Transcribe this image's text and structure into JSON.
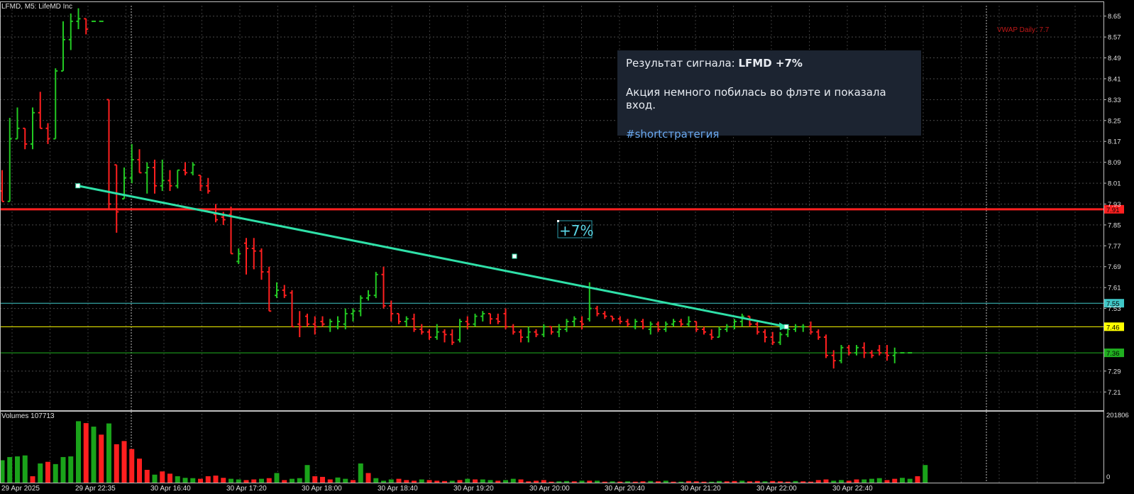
{
  "chart_data": {
    "type": "candlestick",
    "title": "LFMD, M5:  LifeMD Inc",
    "ylim": [
      7.14,
      8.69
    ],
    "y_ticks": [
      "8.65",
      "8.57",
      "8.49",
      "8.41",
      "8.33",
      "8.25",
      "8.17",
      "8.09",
      "8.01",
      "7.93",
      "7.85",
      "7.77",
      "7.69",
      "7.61",
      "7.53",
      "7.29",
      "7.21"
    ],
    "x_tick_labels": [
      "29 Apr 2025",
      "29 Apr 22:35",
      "30 Apr 16:40",
      "30 Apr 17:20",
      "30 Apr 18:00",
      "30 Apr 18:40",
      "30 Apr 19:20",
      "30 Apr 20:00",
      "30 Apr 20:40",
      "30 Apr 21:20",
      "30 Apr 22:00",
      "30 Apr 22:40"
    ],
    "vwap_label": "VWAP Daily: 7.7",
    "price_levels": [
      {
        "label": "7.91",
        "value": 7.91,
        "color": "#ff2020"
      },
      {
        "label": "7.55",
        "value": 7.55,
        "color": "#40c8c8"
      },
      {
        "label": "7.46",
        "value": 7.46,
        "color": "#ffff00"
      },
      {
        "label": "7.36",
        "value": 7.36,
        "color": "#20b020"
      }
    ],
    "trend_line": {
      "start": [
        9,
        8.0
      ],
      "mid": [
        44,
        7.73
      ],
      "end": [
        79,
        7.46
      ]
    },
    "trend_label": "+7%",
    "candles": [
      [
        7.98,
        8.06,
        7.94,
        7.94
      ],
      [
        7.94,
        8.26,
        7.94,
        8.18
      ],
      [
        8.18,
        8.3,
        8.18,
        8.22
      ],
      [
        8.22,
        8.22,
        8.14,
        8.16
      ],
      [
        8.16,
        8.3,
        8.14,
        8.28
      ],
      [
        8.28,
        8.36,
        8.22,
        8.22
      ],
      [
        8.22,
        8.24,
        8.16,
        8.18
      ],
      [
        8.18,
        8.45,
        8.18,
        8.44
      ],
      [
        8.44,
        8.63,
        8.44,
        8.56
      ],
      [
        8.56,
        8.66,
        8.52,
        8.63
      ],
      [
        8.63,
        8.68,
        8.6,
        8.64
      ],
      [
        8.64,
        8.64,
        8.58,
        8.6
      ],
      [
        8.63,
        8.63,
        8.63,
        8.63
      ],
      [
        8.63,
        8.63,
        8.63,
        8.63
      ],
      [
        8.33,
        8.33,
        7.91,
        7.93
      ],
      [
        8.08,
        8.08,
        7.82,
        7.9
      ],
      [
        7.95,
        8.07,
        7.95,
        8.03
      ],
      [
        8.03,
        8.16,
        8.01,
        8.1
      ],
      [
        8.1,
        8.14,
        8.05,
        8.05
      ],
      [
        8.05,
        8.09,
        7.97,
        8.07
      ],
      [
        8.07,
        8.1,
        7.97,
        8.0
      ],
      [
        8.0,
        8.1,
        7.98,
        8.02
      ],
      [
        8.02,
        8.06,
        7.98,
        8.0
      ],
      [
        8.0,
        8.06,
        7.99,
        8.06
      ],
      [
        8.06,
        8.09,
        8.04,
        8.05
      ],
      [
        8.05,
        8.09,
        8.04,
        8.08
      ],
      [
        8.04,
        8.04,
        7.98,
        8.0
      ],
      [
        8.0,
        8.03,
        7.97,
        7.98
      ],
      [
        7.89,
        7.93,
        7.86,
        7.87
      ],
      [
        7.88,
        7.9,
        7.85,
        7.87
      ],
      [
        7.89,
        7.92,
        7.74,
        7.74
      ],
      [
        7.71,
        7.76,
        7.7,
        7.74
      ],
      [
        7.78,
        7.8,
        7.66,
        7.76
      ],
      [
        7.76,
        7.8,
        7.68,
        7.75
      ],
      [
        7.75,
        7.76,
        7.64,
        7.67
      ],
      [
        7.67,
        7.69,
        7.52,
        7.52
      ],
      [
        7.58,
        7.63,
        7.57,
        7.6
      ],
      [
        7.6,
        7.62,
        7.57,
        7.58
      ],
      [
        7.59,
        7.6,
        7.46,
        7.46
      ],
      [
        7.47,
        7.52,
        7.42,
        7.46
      ],
      [
        7.5,
        7.51,
        7.46,
        7.47
      ],
      [
        7.47,
        7.5,
        7.43,
        7.46
      ],
      [
        7.48,
        7.5,
        7.46,
        7.47
      ],
      [
        7.46,
        7.49,
        7.44,
        7.48
      ],
      [
        7.46,
        7.5,
        7.45,
        7.48
      ],
      [
        7.47,
        7.53,
        7.45,
        7.51
      ],
      [
        7.51,
        7.53,
        7.48,
        7.52
      ],
      [
        7.52,
        7.58,
        7.5,
        7.57
      ],
      [
        7.57,
        7.6,
        7.56,
        7.58
      ],
      [
        7.58,
        7.67,
        7.57,
        7.66
      ],
      [
        7.66,
        7.69,
        7.53,
        7.54
      ],
      [
        7.54,
        7.56,
        7.48,
        7.51
      ],
      [
        7.51,
        7.51,
        7.47,
        7.48
      ],
      [
        7.48,
        7.5,
        7.46,
        7.49
      ],
      [
        7.49,
        7.51,
        7.44,
        7.45
      ],
      [
        7.45,
        7.47,
        7.43,
        7.44
      ],
      [
        7.44,
        7.45,
        7.41,
        7.42
      ],
      [
        7.42,
        7.47,
        7.41,
        7.44
      ],
      [
        7.44,
        7.45,
        7.4,
        7.43
      ],
      [
        7.43,
        7.45,
        7.39,
        7.4
      ],
      [
        7.41,
        7.49,
        7.4,
        7.48
      ],
      [
        7.48,
        7.5,
        7.45,
        7.47
      ],
      [
        7.47,
        7.51,
        7.46,
        7.5
      ],
      [
        7.5,
        7.52,
        7.48,
        7.51
      ],
      [
        7.51,
        7.51,
        7.47,
        7.49
      ],
      [
        7.49,
        7.51,
        7.47,
        7.48
      ],
      [
        7.51,
        7.53,
        7.45,
        7.46
      ],
      [
        7.46,
        7.47,
        7.43,
        7.44
      ],
      [
        7.44,
        7.45,
        7.4,
        7.42
      ],
      [
        7.42,
        7.46,
        7.4,
        7.44
      ],
      [
        7.44,
        7.45,
        7.42,
        7.43
      ],
      [
        7.43,
        7.47,
        7.42,
        7.46
      ],
      [
        7.46,
        7.46,
        7.43,
        7.44
      ],
      [
        7.44,
        7.47,
        7.42,
        7.45
      ],
      [
        7.45,
        7.49,
        7.44,
        7.48
      ],
      [
        7.48,
        7.5,
        7.46,
        7.49
      ],
      [
        7.48,
        7.5,
        7.45,
        7.47
      ],
      [
        7.49,
        7.63,
        7.48,
        7.53
      ],
      [
        7.53,
        7.54,
        7.5,
        7.51
      ],
      [
        7.51,
        7.52,
        7.49,
        7.5
      ],
      [
        7.5,
        7.5,
        7.48,
        7.49
      ],
      [
        7.49,
        7.5,
        7.47,
        7.48
      ],
      [
        7.48,
        7.49,
        7.46,
        7.47
      ],
      [
        7.46,
        7.49,
        7.45,
        7.48
      ],
      [
        7.48,
        7.49,
        7.45,
        7.46
      ],
      [
        7.45,
        7.48,
        7.43,
        7.47
      ],
      [
        7.47,
        7.48,
        7.44,
        7.45
      ],
      [
        7.45,
        7.48,
        7.44,
        7.47
      ],
      [
        7.47,
        7.49,
        7.46,
        7.48
      ],
      [
        7.48,
        7.49,
        7.46,
        7.47
      ],
      [
        7.47,
        7.5,
        7.46,
        7.48
      ],
      [
        7.48,
        7.48,
        7.44,
        7.45
      ],
      [
        7.45,
        7.46,
        7.43,
        7.44
      ],
      [
        7.43,
        7.45,
        7.41,
        7.42
      ],
      [
        7.42,
        7.46,
        7.42,
        7.45
      ],
      [
        7.45,
        7.47,
        7.44,
        7.46
      ],
      [
        7.46,
        7.49,
        7.45,
        7.48
      ],
      [
        7.48,
        7.51,
        7.46,
        7.5
      ],
      [
        7.5,
        7.5,
        7.46,
        7.47
      ],
      [
        7.47,
        7.48,
        7.43,
        7.44
      ],
      [
        7.44,
        7.45,
        7.4,
        7.42
      ],
      [
        7.42,
        7.44,
        7.39,
        7.4
      ],
      [
        7.4,
        7.44,
        7.39,
        7.43
      ],
      [
        7.43,
        7.46,
        7.42,
        7.45
      ],
      [
        7.45,
        7.47,
        7.44,
        7.46
      ],
      [
        7.46,
        7.47,
        7.44,
        7.46
      ],
      [
        7.46,
        7.48,
        7.43,
        7.44
      ],
      [
        7.44,
        7.45,
        7.41,
        7.42
      ],
      [
        7.42,
        7.43,
        7.34,
        7.35
      ],
      [
        7.35,
        7.37,
        7.3,
        7.33
      ],
      [
        7.33,
        7.39,
        7.32,
        7.38
      ],
      [
        7.38,
        7.39,
        7.35,
        7.36
      ],
      [
        7.36,
        7.39,
        7.35,
        7.38
      ],
      [
        7.38,
        7.4,
        7.34,
        7.36
      ],
      [
        7.36,
        7.37,
        7.34,
        7.35
      ],
      [
        7.37,
        7.39,
        7.35,
        7.36
      ],
      [
        7.36,
        7.39,
        7.33,
        7.35
      ],
      [
        7.35,
        7.38,
        7.32,
        7.36
      ],
      [
        7.36,
        7.36,
        7.36,
        7.36
      ],
      [
        7.36,
        7.36,
        7.36,
        7.36
      ]
    ],
    "volume_label": "Volumes 107713",
    "volume_max_label": "201806",
    "volume_zero_label": "0",
    "volume_max": 201806,
    "volumes": [
      [
        70000,
        "g"
      ],
      [
        80000,
        "g"
      ],
      [
        82000,
        "g"
      ],
      [
        85000,
        "g"
      ],
      [
        20000,
        "r"
      ],
      [
        60000,
        "g"
      ],
      [
        65000,
        "r"
      ],
      [
        58000,
        "g"
      ],
      [
        80000,
        "g"
      ],
      [
        82000,
        "g"
      ],
      [
        192000,
        "g"
      ],
      [
        186000,
        "r"
      ],
      [
        175000,
        "g"
      ],
      [
        150000,
        "r"
      ],
      [
        185000,
        "g"
      ],
      [
        120000,
        "r"
      ],
      [
        130000,
        "r"
      ],
      [
        105000,
        "r"
      ],
      [
        75000,
        "r"
      ],
      [
        40000,
        "r"
      ],
      [
        25000,
        "g"
      ],
      [
        35000,
        "r"
      ],
      [
        28000,
        "r"
      ],
      [
        20000,
        "g"
      ],
      [
        15000,
        "g"
      ],
      [
        14000,
        "g"
      ],
      [
        12000,
        "r"
      ],
      [
        20000,
        "r"
      ],
      [
        22000,
        "r"
      ],
      [
        15000,
        "r"
      ],
      [
        12000,
        "g"
      ],
      [
        10000,
        "g"
      ],
      [
        8000,
        "r"
      ],
      [
        10000,
        "r"
      ],
      [
        12000,
        "g"
      ],
      [
        14000,
        "r"
      ],
      [
        30000,
        "g"
      ],
      [
        8000,
        "r"
      ],
      [
        12000,
        "g"
      ],
      [
        14000,
        "g"
      ],
      [
        55000,
        "g"
      ],
      [
        20000,
        "r"
      ],
      [
        18000,
        "r"
      ],
      [
        10000,
        "r"
      ],
      [
        16000,
        "g"
      ],
      [
        12000,
        "g"
      ],
      [
        8000,
        "r"
      ],
      [
        60000,
        "g"
      ],
      [
        30000,
        "r"
      ],
      [
        14000,
        "g"
      ],
      [
        6000,
        "g"
      ],
      [
        10000,
        "g"
      ],
      [
        12000,
        "r"
      ],
      [
        8000,
        "r"
      ],
      [
        6000,
        "r"
      ],
      [
        10000,
        "g"
      ],
      [
        8000,
        "r"
      ],
      [
        6000,
        "r"
      ],
      [
        5000,
        "r"
      ],
      [
        6000,
        "g"
      ],
      [
        8000,
        "r"
      ],
      [
        12000,
        "g"
      ],
      [
        10000,
        "r"
      ],
      [
        10000,
        "g"
      ],
      [
        8000,
        "g"
      ],
      [
        6000,
        "r"
      ],
      [
        8000,
        "g"
      ],
      [
        12000,
        "g"
      ],
      [
        10000,
        "r"
      ],
      [
        4000,
        "r"
      ],
      [
        6000,
        "r"
      ],
      [
        8000,
        "r"
      ],
      [
        3000,
        "r"
      ],
      [
        4000,
        "g"
      ],
      [
        5000,
        "g"
      ],
      [
        4000,
        "r"
      ],
      [
        6000,
        "g"
      ],
      [
        6000,
        "r"
      ],
      [
        6000,
        "g"
      ],
      [
        3000,
        "r"
      ],
      [
        4000,
        "g"
      ],
      [
        3000,
        "r"
      ],
      [
        4000,
        "g"
      ],
      [
        3000,
        "r"
      ],
      [
        4000,
        "r"
      ],
      [
        5000,
        "g"
      ],
      [
        4000,
        "r"
      ],
      [
        6000,
        "g"
      ],
      [
        3000,
        "r"
      ],
      [
        3000,
        "g"
      ],
      [
        5000,
        "r"
      ],
      [
        4000,
        "r"
      ],
      [
        3000,
        "r"
      ],
      [
        3000,
        "g"
      ],
      [
        5000,
        "g"
      ],
      [
        4000,
        "r"
      ],
      [
        5000,
        "r"
      ],
      [
        6000,
        "g"
      ],
      [
        4000,
        "r"
      ],
      [
        5000,
        "r"
      ],
      [
        4000,
        "g"
      ],
      [
        5000,
        "r"
      ],
      [
        4000,
        "r"
      ],
      [
        3000,
        "r"
      ],
      [
        5000,
        "g"
      ],
      [
        4000,
        "r"
      ],
      [
        3000,
        "r"
      ],
      [
        8000,
        "r"
      ],
      [
        10000,
        "r"
      ],
      [
        6000,
        "g"
      ],
      [
        8000,
        "g"
      ],
      [
        6000,
        "r"
      ],
      [
        10000,
        "r"
      ],
      [
        10000,
        "g"
      ],
      [
        12000,
        "g"
      ],
      [
        14000,
        "g"
      ],
      [
        8000,
        "r"
      ],
      [
        12000,
        "r"
      ],
      [
        15000,
        "g"
      ],
      [
        12000,
        "g"
      ],
      [
        20000,
        "r"
      ],
      [
        55000,
        "g"
      ]
    ]
  },
  "signal": {
    "result_prefix": "Результат сигнала: ",
    "result_bold": "LFMD +7%",
    "description": "Акция немного побилась во флэте и показала вход.",
    "hashtag": "#shortстратегия"
  }
}
